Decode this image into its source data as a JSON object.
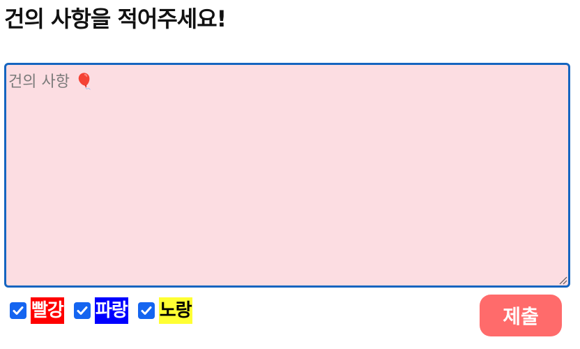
{
  "heading": "건의 사항을 적어주세요!",
  "suggestion": {
    "placeholder": "건의 사항 🎈",
    "value": ""
  },
  "colors": {
    "textarea_border": "#1565c0",
    "textarea_bg": "#fcdde2",
    "checkbox": "#1565f0",
    "submit_bg": "#ff6b6b"
  },
  "options": [
    {
      "label": "빨강",
      "checked": true,
      "bg": "#ff0000",
      "fg": "#ffffff"
    },
    {
      "label": "파랑",
      "checked": true,
      "bg": "#0000ff",
      "fg": "#ffffff"
    },
    {
      "label": "노랑",
      "checked": true,
      "bg": "#ffff33",
      "fg": "#000000"
    }
  ],
  "submit_label": "제출",
  "icons": {
    "checkbox": "check-icon",
    "resize": "resize-grip-icon"
  }
}
